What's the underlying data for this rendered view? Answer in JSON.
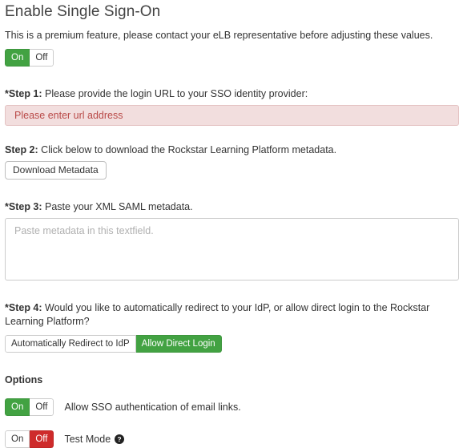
{
  "page": {
    "title": "Enable Single Sign-On",
    "intro": "This is a premium feature, please contact your eLB representative before adjusting these values."
  },
  "master_toggle": {
    "on_label": "On",
    "off_label": "Off",
    "selected": "On"
  },
  "steps": {
    "step1": {
      "marker": "*Step 1:",
      "text": " Please provide the login URL to your SSO identity provider:",
      "input_placeholder": "Please enter url address",
      "input_value": ""
    },
    "step2": {
      "marker": "Step 2:",
      "text": " Click below to download the Rockstar Learning Platform metadata.",
      "button_label": "Download Metadata"
    },
    "step3": {
      "marker": "*Step 3:",
      "text": " Paste your XML SAML metadata.",
      "textarea_placeholder": "Paste metadata in this textfield.",
      "textarea_value": ""
    },
    "step4": {
      "marker": "*Step 4:",
      "text": " Would you like to automatically redirect to your IdP, or allow direct login to the Rockstar Learning Platform?",
      "option_redirect": "Automatically Redirect to IdP",
      "option_direct": "Allow Direct Login",
      "selected": "Allow Direct Login"
    }
  },
  "options": {
    "heading": "Options",
    "email_links": {
      "on_label": "On",
      "off_label": "Off",
      "selected": "On",
      "label": "Allow SSO authentication of email links."
    },
    "test_mode": {
      "on_label": "On",
      "off_label": "Off",
      "selected": "Off",
      "label": "Test Mode",
      "help_icon": "question-circle-icon"
    }
  },
  "colors": {
    "green": "#42a242",
    "red": "#ce2b2b",
    "error_bg": "#f2dede",
    "error_text": "#b94a48",
    "border": "#cccccc",
    "text": "#333333"
  }
}
